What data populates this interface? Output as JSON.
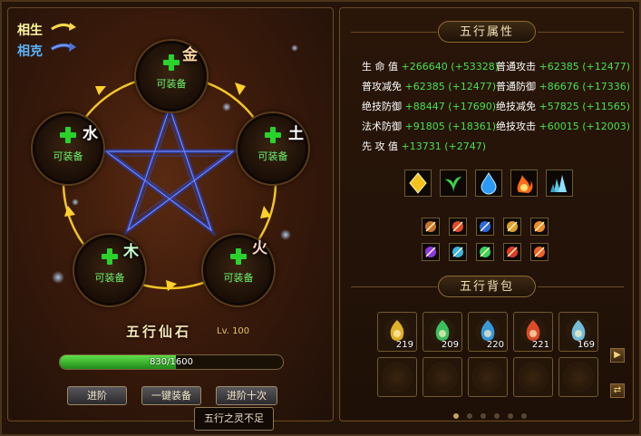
{
  "legend": {
    "sheng": "相生",
    "ke": "相克"
  },
  "elements": {
    "metal": {
      "char": "金",
      "label": "可装备"
    },
    "water": {
      "char": "水",
      "label": "可装备"
    },
    "earth": {
      "char": "土",
      "label": "可装备"
    },
    "wood": {
      "char": "木",
      "label": "可装备"
    },
    "fire": {
      "char": "火",
      "label": "可装备"
    }
  },
  "stone": {
    "name": "五行仙石",
    "level": "Lv. 100"
  },
  "progress": {
    "text": "830/1600",
    "current": 830,
    "max": 1600
  },
  "buttons": {
    "advance": "进阶",
    "one_key_equip": "一键装备",
    "advance_ten": "进阶十次"
  },
  "tooltip": "五行之灵不足",
  "attributes": {
    "title": "五行属性",
    "rows": [
      {
        "label": "生 命 值",
        "value": "+266640 (+53328)"
      },
      {
        "label": "普通攻击",
        "value": "+62385 (+12477)"
      },
      {
        "label": "普攻减免",
        "value": "+62385 (+12477)"
      },
      {
        "label": "普通防御",
        "value": "+86676 (+17336)"
      },
      {
        "label": "绝技防御",
        "value": "+88447 (+17690)"
      },
      {
        "label": "绝技减免",
        "value": "+57825 (+11565)"
      },
      {
        "label": "法术防御",
        "value": "+91805 (+18361)"
      },
      {
        "label": "绝技攻击",
        "value": "+60015 (+12003)"
      },
      {
        "label": "先 攻 值",
        "value": "+13731 (+2747)"
      }
    ]
  },
  "element_icons": [
    "metal-gem-icon",
    "wood-sprout-icon",
    "water-drop-icon",
    "fire-flame-icon",
    "earth-crystal-icon"
  ],
  "small_icons": [
    "warrior-icon",
    "slash-icon",
    "blue-shield-icon",
    "gold-shield-icon",
    "burst-icon",
    "purple-rune-icon",
    "lightning-icon",
    "green-orb-icon",
    "red-demon-icon",
    "flame-strike-icon"
  ],
  "bag": {
    "title": "五行背包",
    "items": [
      {
        "icon": "metal-essence-icon",
        "count": "219"
      },
      {
        "icon": "wood-essence-icon",
        "count": "209"
      },
      {
        "icon": "water-essence-icon",
        "count": "220"
      },
      {
        "icon": "fire-essence-icon",
        "count": "221"
      },
      {
        "icon": "earth-essence-icon",
        "count": "169"
      }
    ]
  },
  "colors": {
    "green": "#49e04a",
    "gold": "#f3d37a",
    "sheng_arrow": "#ffd84a",
    "ke_arrow": "#4a72d8"
  }
}
